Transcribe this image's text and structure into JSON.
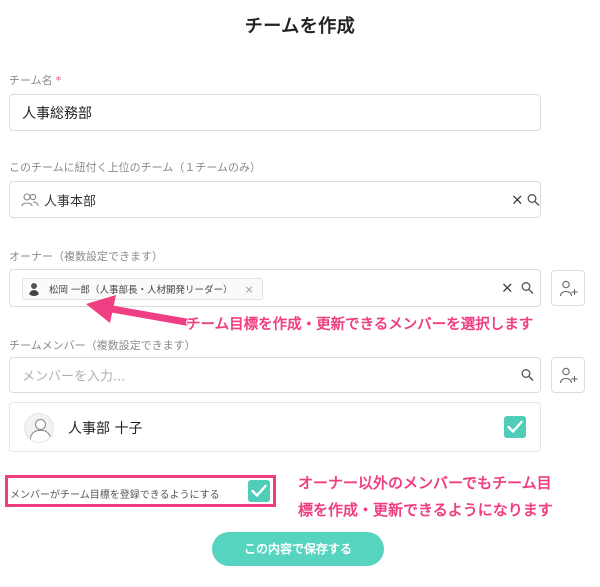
{
  "page": {
    "title": "チームを作成"
  },
  "team_name": {
    "label": "チーム名",
    "required_mark": "*",
    "value": "人事総務部"
  },
  "parent_team": {
    "label": "このチームに紐付く上位のチーム（１チームのみ）",
    "value": "人事本部"
  },
  "owner": {
    "label": "オーナー（複数設定できます）",
    "chip_text": "松岡 一郎（人事部長・人材開発リーダー）",
    "chip_close": "×"
  },
  "members": {
    "label": "チームメンバー（複数設定できます）",
    "placeholder": "メンバーを入力...",
    "list": [
      {
        "name": "人事部 十子",
        "checked": true
      }
    ]
  },
  "member_register_setting": {
    "label": "メンバーがチーム目標を登録できるようにする",
    "checked": true
  },
  "save_button": {
    "label": "この内容で保存する"
  },
  "annotations": {
    "owner_note": "チーム目標を作成・更新できるメンバーを選択します",
    "member_note_line1": "オーナー以外のメンバーでもチーム目",
    "member_note_line2": "標を作成・更新できるようになります"
  },
  "controls": {
    "clear_glyph": "×"
  },
  "colors": {
    "accent": "#56d4c0",
    "check": "#4fcdb8",
    "annotation": "#ef3f82",
    "required": "#e0556b"
  }
}
